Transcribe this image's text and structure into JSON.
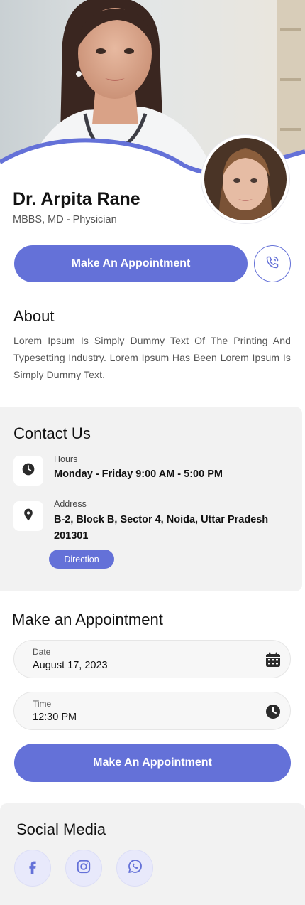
{
  "profile": {
    "name": "Dr. Arpita Rane",
    "degree": "MBBS, MD - Physician",
    "cover_photo": "doctor-photo",
    "avatar": "avatar-photo"
  },
  "actions": {
    "appointment_label": "Make An Appointment",
    "call_icon": "phone-icon"
  },
  "about": {
    "title": "About",
    "text": "Lorem Ipsum Is Simply Dummy Text Of The Printing And Typesetting Industry. Lorem Ipsum Has Been Lorem Ipsum Is Simply Dummy Text."
  },
  "contact": {
    "title": "Contact Us",
    "hours_label": "Hours",
    "hours_value": "Monday - Friday 9:00 AM - 5:00 PM",
    "address_label": "Address",
    "address_value": "B-2, Block B, Sector 4, Noida, Uttar Pradesh 201301",
    "direction_label": "Direction"
  },
  "appointment": {
    "title": "Make an Appointment",
    "date_label": "Date",
    "date_value": "August 17, 2023",
    "time_label": "Time",
    "time_value": "12:30 PM",
    "submit_label": "Make An Appointment"
  },
  "social": {
    "title": "Social Media",
    "icons": [
      "facebook-icon",
      "instagram-icon",
      "whatsapp-icon"
    ]
  },
  "colors": {
    "accent": "#6471d8",
    "card_bg": "#f2f2f2",
    "social_bg": "#e8e9fb"
  }
}
